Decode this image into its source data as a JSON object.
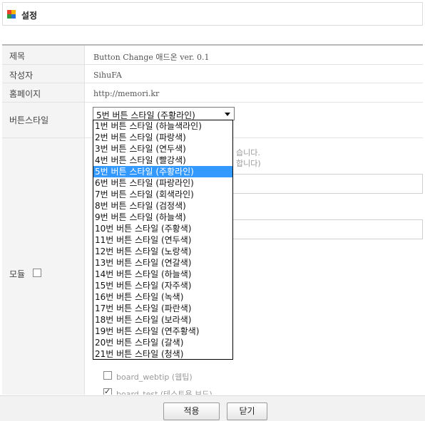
{
  "header": {
    "title": "설정"
  },
  "brand_colors": {
    "logo": [
      "#e8402a",
      "#f5b400",
      "#2f9a3d",
      "#2a6fd6"
    ],
    "selection": "#3399ff"
  },
  "rows": {
    "title": {
      "label": "제목",
      "value": "Button Change 애드온 ver. 0.1"
    },
    "author": {
      "label": "작성자",
      "value": "SihuFA"
    },
    "homepage": {
      "label": "홈페이지",
      "value": "http://memori.kr"
    },
    "button_style": {
      "label": "버튼스타일",
      "selected": "5번 버튼 스타일 (주황라인)"
    },
    "module": {
      "label": "모듈"
    }
  },
  "hidden_text": {
    "line1": "습니다.",
    "line2": "합니다)"
  },
  "modules": [
    {
      "label": "board_webtip (웹팁)",
      "checked": false
    },
    {
      "label": "board_test (테스트용 보드)",
      "checked": true
    }
  ],
  "dropdown": {
    "options": [
      "1번 버튼 스타일 (하늘색라인)",
      "2번 버튼 스타일 (파랑색)",
      "3번 버튼 스타일 (연두색)",
      "4번 버튼 스타일 (빨강색)",
      "5번 버튼 스타일 (주황라인)",
      "6번 버튼 스타일 (파랑라인)",
      "7번 버튼 스타일 (회색라인)",
      "8번 버튼 스타일 (검정색)",
      "9번 버튼 스타일 (하늘색)",
      "10번 버튼 스타일 (주황색)",
      "11번 버튼 스타일 (연두색)",
      "12번 버튼 스타일 (노랑색)",
      "13번 버튼 스타일 (연갈색)",
      "14번 버튼 스타일 (하늘색)",
      "15번 버튼 스타일 (자주색)",
      "16번 버튼 스타일 (녹색)",
      "17번 버튼 스타일 (파란색)",
      "18번 버튼 스타일 (보라색)",
      "19번 버튼 스타일 (연주황색)",
      "20번 버튼 스타일 (갈색)",
      "21번 버튼 스타일 (청색)"
    ],
    "selected_index": 4
  },
  "footer": {
    "apply_label": "적용",
    "close_label": "닫기"
  }
}
